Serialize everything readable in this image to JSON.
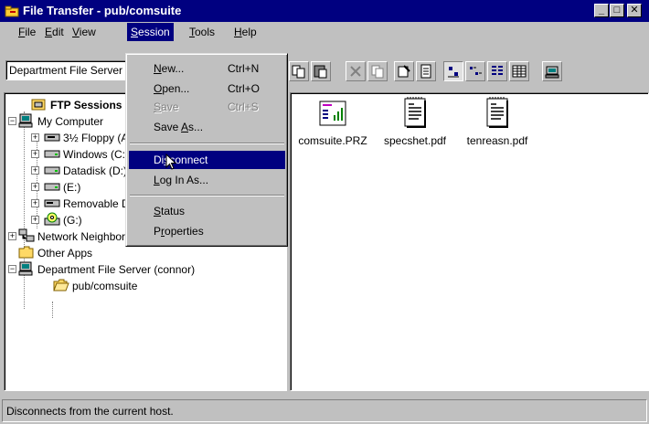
{
  "window": {
    "title": "File Transfer - pub/comsuite",
    "controls": {
      "minimize": "_",
      "maximize": "□",
      "close": "✕"
    }
  },
  "menubar": [
    {
      "first": "F",
      "rest": "ile"
    },
    {
      "first": "E",
      "rest": "dit"
    },
    {
      "first": "V",
      "rest": "iew"
    },
    {
      "first": "S",
      "rest": "ession"
    },
    {
      "first": "T",
      "rest": "ools"
    },
    {
      "first": "H",
      "rest": "elp"
    }
  ],
  "toolbar": {
    "location_value": "Department File Server (connor)",
    "buttons": [
      "paste-icon",
      "delete-icon",
      "copy-icon",
      "properties-icon",
      "new-folder-icon",
      "large-icons-icon",
      "small-icons-icon",
      "list-icon",
      "details-icon",
      "disconnect-icon"
    ]
  },
  "session_menu": {
    "items": [
      {
        "pre": "",
        "u": "N",
        "post": "ew...",
        "shortcut": "Ctrl+N",
        "state": "enabled"
      },
      {
        "pre": "",
        "u": "O",
        "post": "pen...",
        "shortcut": "Ctrl+O",
        "state": "enabled"
      },
      {
        "pre": "",
        "u": "S",
        "post": "ave",
        "shortcut": "Ctrl+S",
        "state": "disabled"
      },
      {
        "pre": "Save ",
        "u": "A",
        "post": "s...",
        "shortcut": "",
        "state": "enabled"
      },
      {
        "pre": "Di",
        "u": "s",
        "post": "connect",
        "shortcut": "",
        "state": "highlighted"
      },
      {
        "pre": "",
        "u": "L",
        "post": "og In As...",
        "shortcut": "",
        "state": "enabled"
      },
      {
        "pre": "",
        "u": "S",
        "post": "tatus",
        "shortcut": "",
        "state": "enabled"
      },
      {
        "pre": "P",
        "u": "r",
        "post": "operties",
        "shortcut": "",
        "state": "enabled"
      }
    ]
  },
  "tree": {
    "items": [
      {
        "label": "FTP Sessions",
        "icon": "ftp-sessions-icon"
      },
      {
        "label": "My Computer",
        "icon": "computer-icon"
      },
      {
        "label": "3½ Floppy (A:)",
        "icon": "floppy-drive-icon"
      },
      {
        "label": "Windows (C:)",
        "icon": "hard-drive-icon"
      },
      {
        "label": "Datadisk (D:)",
        "icon": "hard-drive-icon"
      },
      {
        "label": "(E:)",
        "icon": "hard-drive-icon"
      },
      {
        "label": "Removable Disk (F:)",
        "icon": "removable-drive-icon"
      },
      {
        "label": "(G:)",
        "icon": "cd-drive-icon"
      },
      {
        "label": "Network Neighborhood",
        "icon": "network-icon"
      },
      {
        "label": "Other Apps",
        "icon": "folder-icon"
      },
      {
        "label": "Department File Server (connor)",
        "icon": "server-icon"
      },
      {
        "label": "pub/comsuite",
        "icon": "open-folder-icon"
      }
    ]
  },
  "files": [
    {
      "name": "comsuite.PRZ",
      "icon": "presentation-file-icon"
    },
    {
      "name": "specshet.pdf",
      "icon": "document-file-icon"
    },
    {
      "name": "tenreasn.pdf",
      "icon": "document-file-icon"
    }
  ],
  "status": {
    "text": "Disconnects from the current host."
  },
  "colors": {
    "title_bar": "#000080",
    "highlight": "#000080",
    "face": "#c0c0c0"
  }
}
